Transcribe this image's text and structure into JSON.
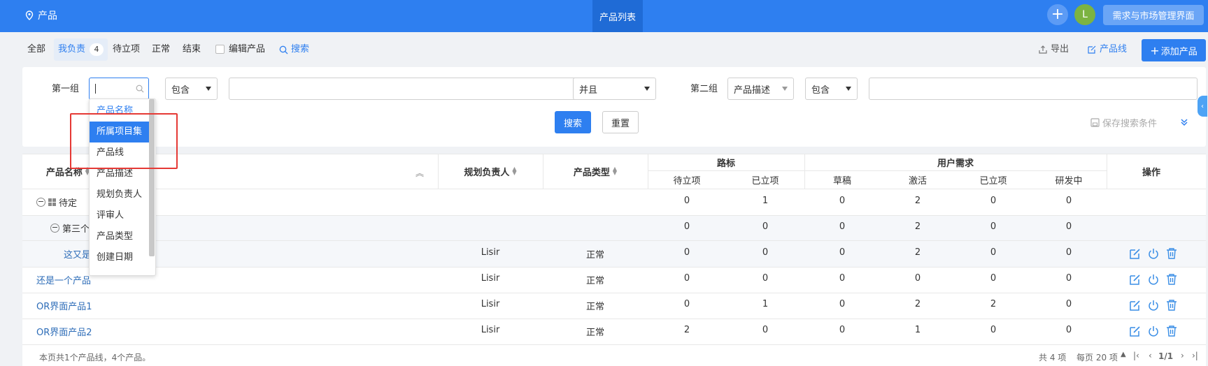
{
  "topbar": {
    "module": "产品",
    "center_tab": "产品列表",
    "plus": "+",
    "avatar": "L",
    "right_button": "需求与市场管理界面"
  },
  "subnav": {
    "all": "全部",
    "mine": "我负责",
    "mine_count": "4",
    "pending": "待立项",
    "normal": "正常",
    "ended": "结束",
    "edit_products": "编辑产品",
    "search": "搜索",
    "export": "导出",
    "product_line": "产品线",
    "add_product": "添加产品"
  },
  "search": {
    "group1": "第一组",
    "field1_value": "",
    "op1": "包含",
    "logic": "并且",
    "group2": "第二组",
    "field2": "产品描述",
    "op2": "包含",
    "search_btn": "搜索",
    "reset_btn": "重置",
    "save_conditions": "保存搜索条件"
  },
  "dropdown": {
    "items": [
      "产品名称",
      "所属项目集",
      "产品线",
      "产品描述",
      "规划负责人",
      "评审人",
      "产品类型",
      "创建日期"
    ],
    "selected": "所属项目集"
  },
  "table": {
    "headers": {
      "name": "产品名称",
      "owner": "规划负责人",
      "type": "产品类型",
      "roadmap": "路标",
      "roadmap_pending": "待立项",
      "roadmap_approved": "已立项",
      "requirements": "用户需求",
      "req_draft": "草稿",
      "req_active": "激活",
      "req_approved": "已立项",
      "req_dev": "研发中",
      "actions": "操作"
    },
    "rows": [
      {
        "name": "待定",
        "owner": "",
        "type": "",
        "rp": "0",
        "ra": "1",
        "d": "0",
        "ac": "2",
        "ap": "0",
        "dv": "0"
      },
      {
        "name": "第三个",
        "owner": "",
        "type": "",
        "rp": "0",
        "ra": "0",
        "d": "0",
        "ac": "2",
        "ap": "0",
        "dv": "0"
      },
      {
        "name": "这又是",
        "owner": "Lisir",
        "type": "正常",
        "rp": "0",
        "ra": "0",
        "d": "0",
        "ac": "2",
        "ap": "0",
        "dv": "0"
      },
      {
        "name": "还是一个产品",
        "owner": "Lisir",
        "type": "正常",
        "rp": "0",
        "ra": "0",
        "d": "0",
        "ac": "0",
        "ap": "0",
        "dv": "0"
      },
      {
        "name": "OR界面产品1",
        "owner": "Lisir",
        "type": "正常",
        "rp": "0",
        "ra": "1",
        "d": "0",
        "ac": "2",
        "ap": "2",
        "dv": "0"
      },
      {
        "name": "OR界面产品2",
        "owner": "Lisir",
        "type": "正常",
        "rp": "2",
        "ra": "0",
        "d": "0",
        "ac": "1",
        "ap": "0",
        "dv": "0"
      }
    ]
  },
  "footer": {
    "summary": "本页共1个产品线，4个产品。",
    "total": "共 4 项",
    "per_page": "每页 20 项",
    "page": "1/1"
  }
}
